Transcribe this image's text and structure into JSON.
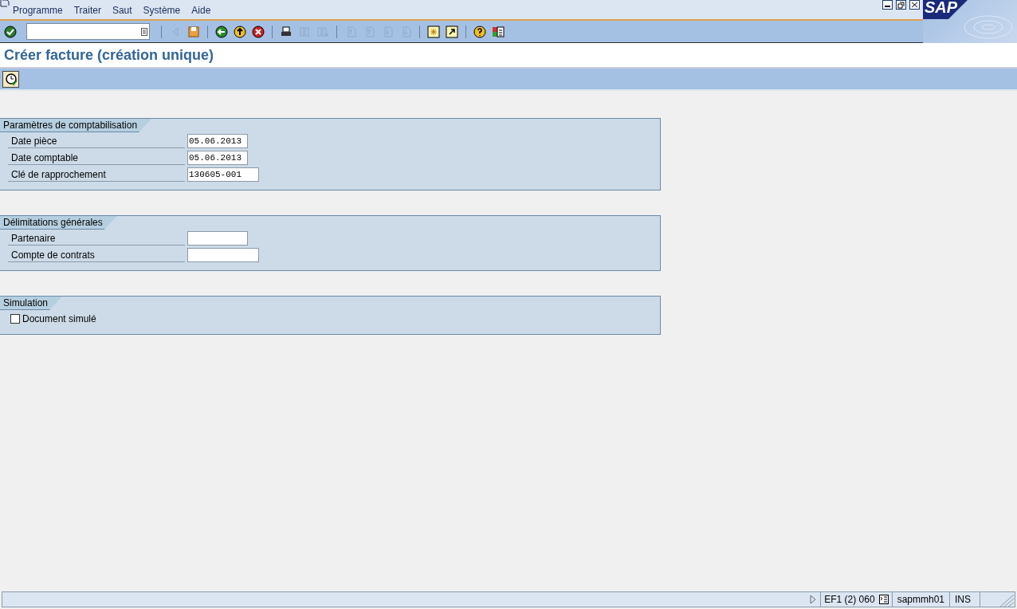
{
  "menu": [
    {
      "label": "Programme"
    },
    {
      "label": "Traiter"
    },
    {
      "label": "Saut"
    },
    {
      "label": "Système"
    },
    {
      "label": "Aide"
    }
  ],
  "toolbar": [
    {
      "kind": "enter",
      "disabled": false
    },
    {
      "kind": "command-field"
    },
    {
      "kind": "sep"
    },
    {
      "kind": "expand",
      "disabled": true
    },
    {
      "kind": "save",
      "disabled": false
    },
    {
      "kind": "sep"
    },
    {
      "kind": "back",
      "disabled": false
    },
    {
      "kind": "exit",
      "disabled": false
    },
    {
      "kind": "cancel",
      "disabled": false
    },
    {
      "kind": "sep"
    },
    {
      "kind": "print",
      "disabled": false
    },
    {
      "kind": "find",
      "disabled": true
    },
    {
      "kind": "find-next",
      "disabled": true
    },
    {
      "kind": "sep"
    },
    {
      "kind": "first-page",
      "disabled": true
    },
    {
      "kind": "prev-page",
      "disabled": true
    },
    {
      "kind": "next-page",
      "disabled": true
    },
    {
      "kind": "last-page",
      "disabled": true
    },
    {
      "kind": "sep"
    },
    {
      "kind": "new-session",
      "disabled": false
    },
    {
      "kind": "shortcut",
      "disabled": false
    },
    {
      "kind": "sep"
    },
    {
      "kind": "help",
      "disabled": false
    },
    {
      "kind": "layout",
      "disabled": false
    }
  ],
  "logo": "SAP",
  "title": "Créer facture (création unique)",
  "groups": [
    {
      "title": "Paramètres de comptabilisation",
      "fields": [
        {
          "kind": "short-input",
          "label": "Date pièce",
          "value": "05.06.2013"
        },
        {
          "kind": "short-input",
          "label": "Date comptable",
          "value": "05.06.2013"
        },
        {
          "kind": "long-input",
          "label": "Clé de rapprochement",
          "value": "130605-001"
        }
      ]
    },
    {
      "title": "Délimitations générales",
      "fields": [
        {
          "kind": "short-input",
          "label": "Partenaire"
        },
        {
          "kind": "long-input",
          "label": "Compte de contrats"
        }
      ]
    },
    {
      "title": "Simulation",
      "fields": [
        {
          "kind": "checkbox",
          "label": "Document simulé",
          "checked": false
        }
      ]
    }
  ],
  "status_bar": {
    "system": "EF1 (2) 060",
    "server": "sapmmh01",
    "mode": "INS"
  }
}
